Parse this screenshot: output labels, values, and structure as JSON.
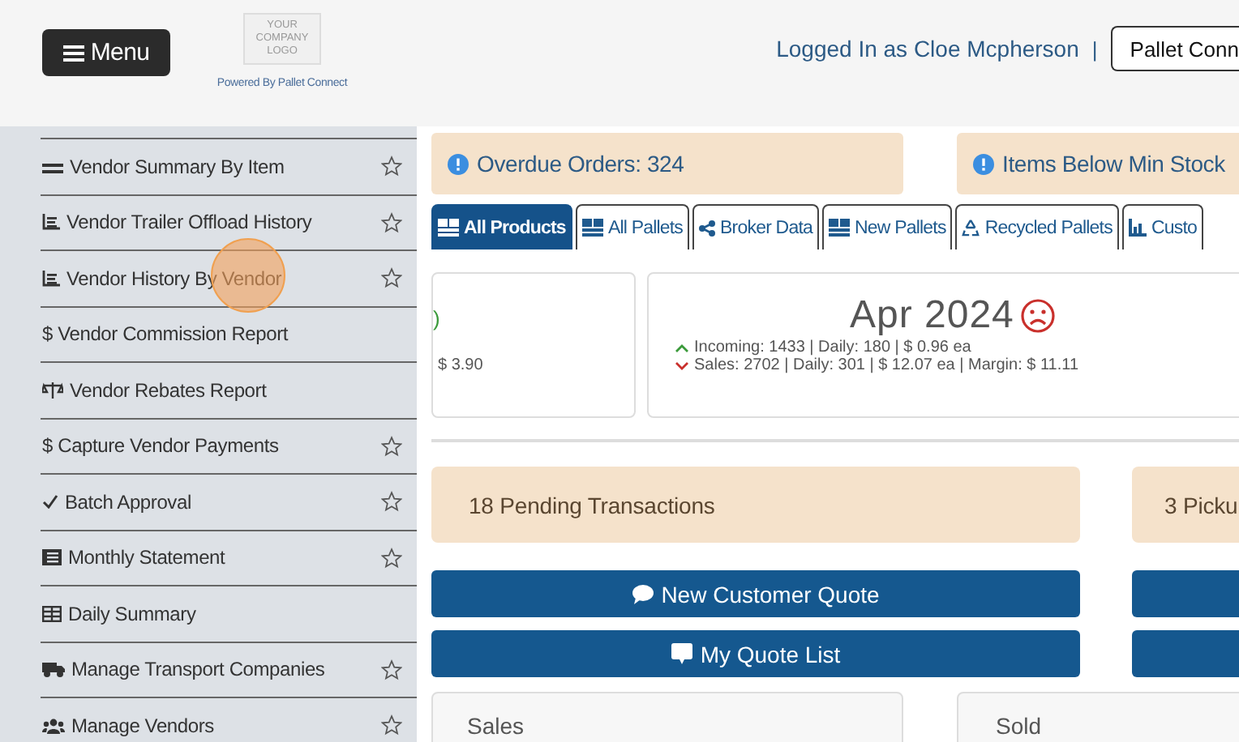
{
  "header": {
    "menu_button": "Menu",
    "logo": "YOUR COMPANY LOGO",
    "powered_by": "Powered By Pallet Connect",
    "user": "Logged In as Cloe Mcpherson",
    "separator": "|",
    "app_button": "Pallet Conn"
  },
  "sidebar": {
    "items": [
      {
        "label": "Vendor Summary By Item",
        "star": true
      },
      {
        "label": "Vendor Trailer Offload History",
        "star": true
      },
      {
        "label": "Vendor History By Vendor",
        "star": true
      },
      {
        "label": "$ Vendor Commission Report",
        "star": false
      },
      {
        "label": "Vendor Rebates Report",
        "star": false
      },
      {
        "label": "$ Capture Vendor Payments",
        "star": true
      },
      {
        "label": "Batch Approval",
        "star": true
      },
      {
        "label": "Monthly Statement",
        "star": true
      },
      {
        "label": "Daily Summary",
        "star": false
      },
      {
        "label": "Manage Transport Companies",
        "star": true
      },
      {
        "label": "Manage Vendors",
        "star": true
      }
    ]
  },
  "alerts": [
    "Overdue Orders: 324",
    "Items Below Min Stock"
  ],
  "tabs": [
    {
      "label": "All Products",
      "selected": true
    },
    {
      "label": "All Pallets",
      "selected": false
    },
    {
      "label": "Broker Data",
      "selected": false
    },
    {
      "label": "New Pallets",
      "selected": false
    },
    {
      "label": "Recycled Pallets",
      "selected": false
    },
    {
      "label": "Custo",
      "selected": false
    }
  ],
  "stats": {
    "prev_mark": ")",
    "prev_value": "$ 3.90",
    "month": "Apr 2024",
    "incoming": "Incoming: 1433 | Daily: 180 | $ 0.96 ea",
    "sales": "Sales: 2702 | Daily: 301 | $ 12.07 ea | Margin: $ 11.11"
  },
  "notices": [
    "18 Pending Transactions",
    "3 Picku"
  ],
  "buttons": [
    "New Customer Quote",
    "My Quote List"
  ],
  "panels": [
    "Sales",
    "Sold"
  ]
}
